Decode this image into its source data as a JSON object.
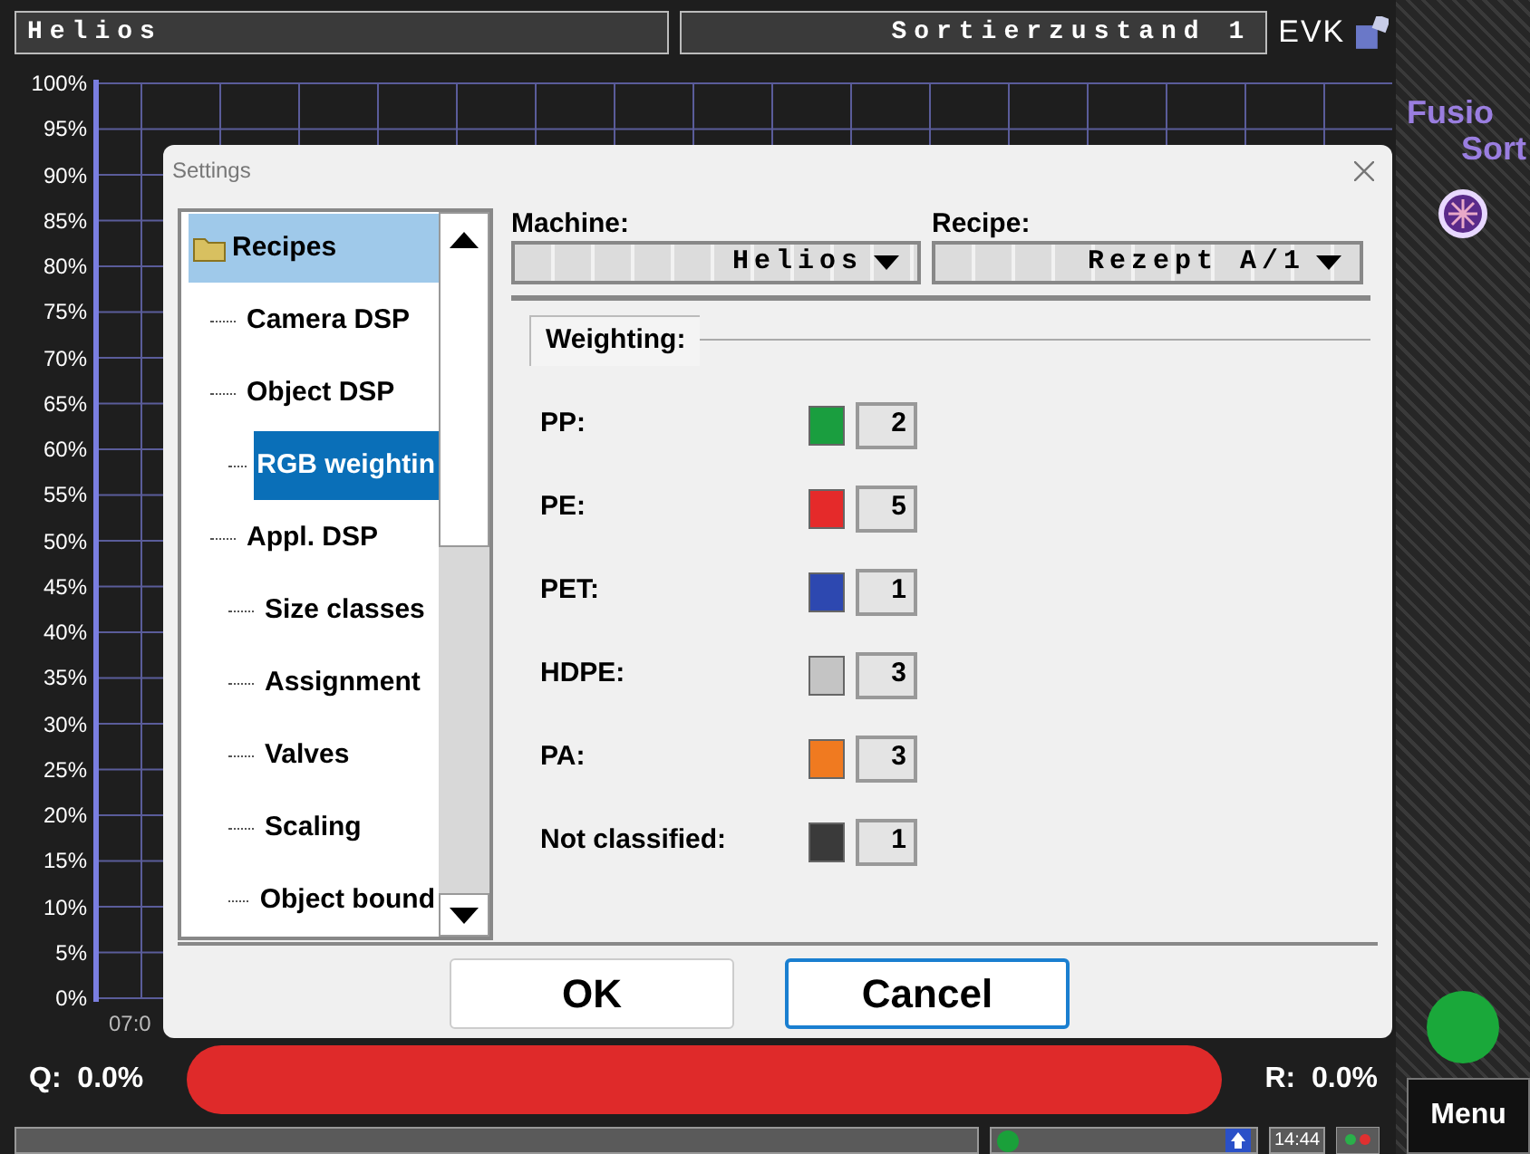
{
  "header": {
    "machine": "Helios",
    "state": "Sortierzustand 1",
    "logo": "EVK"
  },
  "chart": {
    "y_labels": [
      "100%",
      "95%",
      "90%",
      "85%",
      "80%",
      "75%",
      "70%",
      "65%",
      "60%",
      "55%",
      "50%",
      "45%",
      "40%",
      "35%",
      "30%",
      "25%",
      "20%",
      "15%",
      "10%",
      "5%",
      "0%"
    ],
    "x_label": "07:0"
  },
  "brand": {
    "line_1": "Fusio",
    "line_2": "Sort"
  },
  "dialog": {
    "title": "Settings",
    "tree": [
      {
        "label": "Recipes",
        "selected": false,
        "highlighted": true,
        "children": [
          {
            "label": "Camera DSP",
            "selected": false,
            "highlighted": false
          },
          {
            "label": "Object DSP",
            "selected": false,
            "highlighted": false,
            "children": [
              {
                "label": "RGB weightin",
                "selected": true,
                "highlighted": false
              }
            ]
          },
          {
            "label": "Appl. DSP",
            "selected": false,
            "highlighted": false,
            "children": [
              {
                "label": "Size classes",
                "selected": false,
                "highlighted": false
              },
              {
                "label": "Assignment",
                "selected": false,
                "highlighted": false
              },
              {
                "label": "Valves",
                "selected": false,
                "highlighted": false
              },
              {
                "label": "Scaling",
                "selected": false,
                "highlighted": false
              },
              {
                "label": "Object bound",
                "selected": false,
                "highlighted": false
              }
            ]
          }
        ]
      }
    ],
    "machine": {
      "label": "Machine:",
      "value": "Helios"
    },
    "recipe": {
      "label": "Recipe:",
      "value": "Rezept A/1"
    },
    "group_title": "Weighting:",
    "weights": [
      {
        "label": "PP:",
        "color": "#1a9e3f",
        "value": "2"
      },
      {
        "label": "PE:",
        "color": "#e52a2a",
        "value": "5"
      },
      {
        "label": "PET:",
        "color": "#2d48b0",
        "value": "1"
      },
      {
        "label": "HDPE:",
        "color": "#c4c4c4",
        "value": "3"
      },
      {
        "label": "PA:",
        "color": "#f07a20",
        "value": "3"
      },
      {
        "label": "Not classified:",
        "color": "#3a3a3a",
        "value": "1"
      }
    ],
    "buttons": [
      {
        "label": "OK",
        "focused": false
      },
      {
        "label": "Cancel",
        "focused": true
      }
    ]
  },
  "quality": {
    "q": "Q:  0.0%",
    "r": "R:  0.0%"
  },
  "status": {
    "time": "14:44"
  },
  "menu": "Menu"
}
